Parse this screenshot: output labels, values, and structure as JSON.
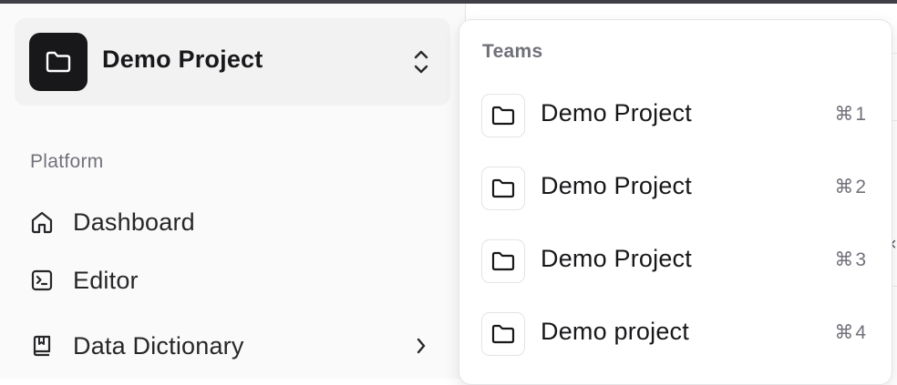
{
  "sidebar": {
    "team_switcher": {
      "name": "Demo Project",
      "logo_icon": "folder-icon",
      "toggle_icon": "chevrons-up-down-icon"
    },
    "section_label": "Platform",
    "nav_items": [
      {
        "label": "Dashboard",
        "icon": "home-icon"
      },
      {
        "label": "Editor",
        "icon": "terminal-icon"
      },
      {
        "label": "Data Dictionary",
        "icon": "book-icon",
        "has_submenu": true
      }
    ]
  },
  "dropdown": {
    "heading": "Teams",
    "items": [
      {
        "label": "Demo Project",
        "shortcut": "⌘1",
        "icon": "folder-icon"
      },
      {
        "label": "Demo Project",
        "shortcut": "⌘2",
        "icon": "folder-icon"
      },
      {
        "label": "Demo Project",
        "shortcut": "⌘3",
        "icon": "folder-icon"
      },
      {
        "label": "Demo project",
        "shortcut": "⌘4",
        "icon": "folder-icon"
      }
    ]
  },
  "colors": {
    "accent_dark": "#18181b",
    "muted_text": "#71717a",
    "sidebar_bg": "#fafafa",
    "border": "#e4e4e7"
  }
}
